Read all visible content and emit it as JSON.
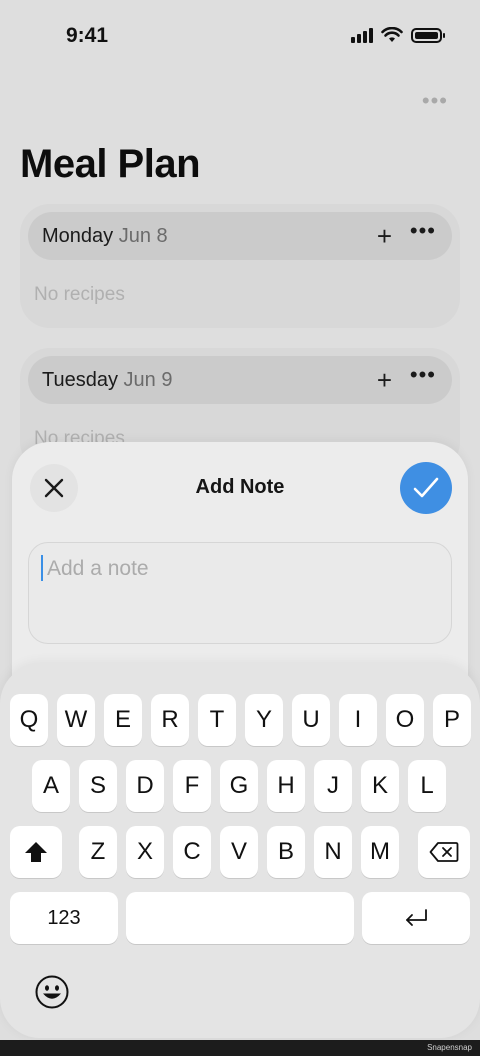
{
  "status_bar": {
    "time": "9:41",
    "signal_icon": "signal-icon",
    "wifi_icon": "wifi-icon",
    "battery_icon": "battery-icon"
  },
  "header": {
    "more_icon": "ellipsis-icon",
    "more_label": "•••",
    "title": "Meal Plan"
  },
  "days": [
    {
      "day": "Monday",
      "date": "Jun 8",
      "add_label": "+",
      "more_label": "•••",
      "empty_text": "No recipes"
    },
    {
      "day": "Tuesday",
      "date": "Jun 9",
      "add_label": "+",
      "more_label": "•••",
      "empty_text": "No recipes"
    }
  ],
  "note_sheet": {
    "title": "Add Note",
    "close_icon": "close-icon",
    "confirm_icon": "checkmark-icon",
    "input_value": "",
    "placeholder": "Add a note",
    "accent_color": "#3f8fe3"
  },
  "keyboard": {
    "row1": [
      "Q",
      "W",
      "E",
      "R",
      "T",
      "Y",
      "U",
      "I",
      "O",
      "P"
    ],
    "row2": [
      "A",
      "S",
      "D",
      "F",
      "G",
      "H",
      "J",
      "K",
      "L"
    ],
    "row3": [
      "Z",
      "X",
      "C",
      "V",
      "B",
      "N",
      "M"
    ],
    "shift_icon": "shift-icon",
    "delete_icon": "backspace-icon",
    "numbers_label": "123",
    "return_icon": "return-icon",
    "emoji_icon": "emoji-icon"
  },
  "watermark": "Snapensnap"
}
